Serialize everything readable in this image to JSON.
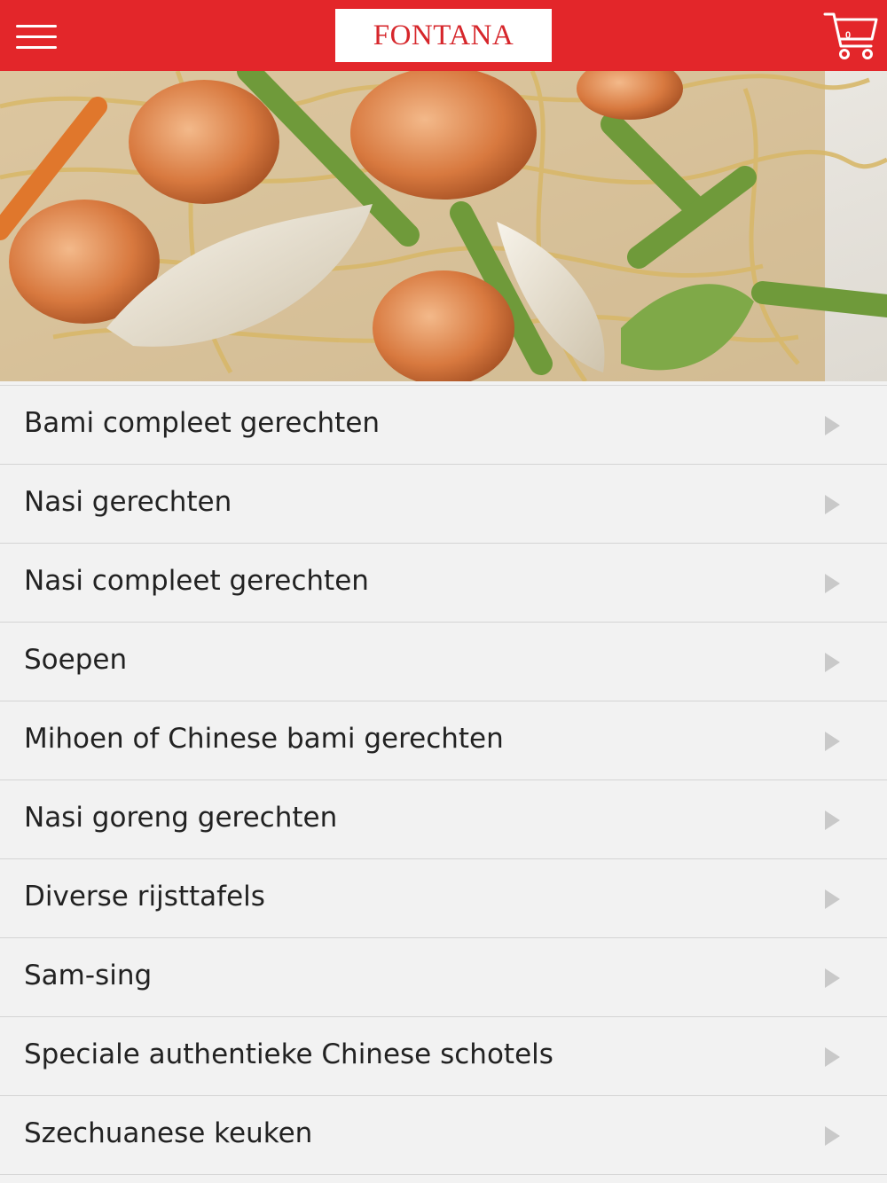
{
  "header": {
    "brand": "FONTANA",
    "cart_count": "0",
    "menu_icon": "hamburger-icon",
    "cart_icon": "cart-icon",
    "bar_color": "#e3262a"
  },
  "hero": {
    "image": "stir-fried noodles with shrimp and vegetables"
  },
  "categories": [
    {
      "label": "Bami compleet gerechten"
    },
    {
      "label": "Nasi gerechten"
    },
    {
      "label": "Nasi compleet gerechten"
    },
    {
      "label": "Soepen"
    },
    {
      "label": "Mihoen of Chinese bami gerechten"
    },
    {
      "label": "Nasi goreng gerechten"
    },
    {
      "label": "Diverse rijsttafels"
    },
    {
      "label": "Sam-sing"
    },
    {
      "label": "Speciale authentieke Chinese schotels"
    },
    {
      "label": "Szechuanese keuken"
    }
  ]
}
